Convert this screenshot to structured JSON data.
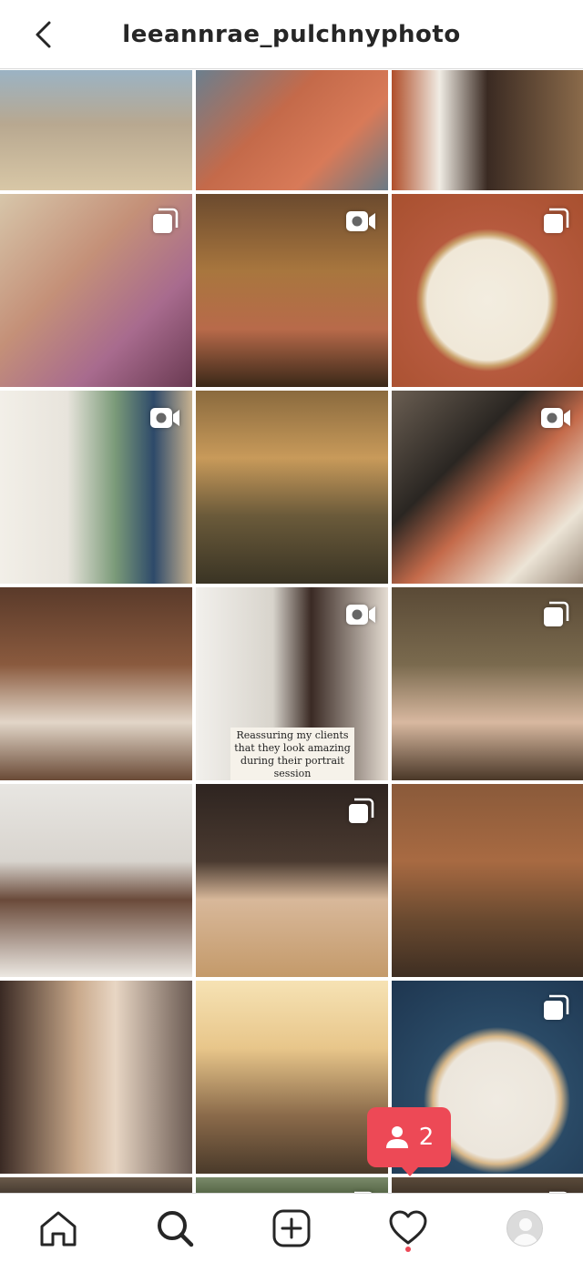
{
  "header": {
    "title": "leeannrae_pulchnyphoto"
  },
  "caption_text": "Reassuring my clients that they look amazing during their portrait session",
  "notification": {
    "count": "2"
  },
  "colors": {
    "accent": "#ed4956",
    "border": "#dbdbdb",
    "text": "#262626"
  },
  "tiles": [
    {
      "desc": "family-beach",
      "icon": "",
      "bg": "linear-gradient(180deg,#9bb3c4 0%,#b8a890 45%,#d8c7a6 100%)"
    },
    {
      "desc": "string-craft",
      "icon": "",
      "bg": "linear-gradient(135deg,#6b7f8e 0%,#c46a4a 40%,#d87a58 70%,#6a7a85 100%)"
    },
    {
      "desc": "woman-porch",
      "icon": "",
      "bg": "linear-gradient(90deg,#b04f2a 0%,#f0ece4 25%,#3a2a22 50%,#8a6a4a 100%)"
    },
    {
      "desc": "mother-baby",
      "icon": "carousel",
      "bg": "linear-gradient(135deg,#d7c6aa 0%,#c49078 40%,#a86b8e 70%,#6a3a52 100%)"
    },
    {
      "desc": "girl-bubbles",
      "icon": "video",
      "bg": "linear-gradient(180deg,#6b4a2e 0%,#a8763e 40%,#b86a4a 70%,#3a2818 100%)"
    },
    {
      "desc": "embroidery-chickens",
      "icon": "carousel",
      "bg": "radial-gradient(circle at 50% 55%,#f3ede0 0%,#f0e8d8 42%,#c9a06a 46%,#b65a3e 50%,#a8502f 100%)"
    },
    {
      "desc": "books-vase",
      "icon": "video",
      "bg": "linear-gradient(90deg,#f2efe8 0%,#e8e4dc 35%,#7a9a78 60%,#2e4a6a 80%,#c8b290 100%)"
    },
    {
      "desc": "mom-kid-river",
      "icon": "",
      "bg": "linear-gradient(180deg,#8a6a3e 0%,#c89a5a 35%,#6a5a3a 65%,#3a3424 100%)"
    },
    {
      "desc": "camera-embroidery",
      "icon": "video",
      "bg": "linear-gradient(135deg,#6a5e52 0%,#2a2622 35%,#c46a4a 55%,#ece4d6 80%,#9a8a7a 100%)"
    },
    {
      "desc": "girl-tree",
      "icon": "",
      "bg": "linear-gradient(180deg,#5a3a2a 0%,#8a5a3e 40%,#e2d6c8 70%,#6a4a36 100%)"
    },
    {
      "desc": "woman-camera",
      "icon": "video",
      "bg": "linear-gradient(90deg,#f2f0ec 0%,#d8d4cc 40%,#3a2a24 60%,#e4dcd2 100%)"
    },
    {
      "desc": "pampas-vase",
      "icon": "carousel",
      "bg": "linear-gradient(180deg,#5a4a36 0%,#7a6a4e 40%,#d8b8a0 70%,#4a3828 100%)"
    },
    {
      "desc": "woman-sweater",
      "icon": "",
      "bg": "linear-gradient(180deg,#e8e6e2 0%,#d8d4ce 40%,#6a4a3a 60%,#ece8e2 100%)"
    },
    {
      "desc": "baby-birthday",
      "icon": "carousel",
      "bg": "linear-gradient(180deg,#2e2420 0%,#4a3a30 40%,#d8b89a 60%,#c49a6a 100%)"
    },
    {
      "desc": "family-big-tree",
      "icon": "",
      "bg": "linear-gradient(180deg,#8a5a3a 0%,#a86a42 40%,#6a4a30 70%,#3e2e22 100%)"
    },
    {
      "desc": "couple-closeup",
      "icon": "",
      "bg": "linear-gradient(90deg,#3a2a24 0%,#c8a88a 40%,#e8d6c4 60%,#6a5a52 100%)"
    },
    {
      "desc": "family-field-sunset",
      "icon": "",
      "bg": "linear-gradient(180deg,#f6e2b4 0%,#e8c68a 35%,#8a6a4a 70%,#4a3a2a 100%)"
    },
    {
      "desc": "embroidery-heart",
      "icon": "carousel",
      "bg": "radial-gradient(circle at 55% 62%,#f0ebe2 0%,#ece6dc 36%,#d8b88a 40%,#2a4a66 46%,#1e3650 100%)"
    },
    {
      "desc": "row-bottom-1",
      "icon": "",
      "bg": "linear-gradient(180deg,#6a5a4a 0%,#3a3028 100%)"
    },
    {
      "desc": "row-bottom-2",
      "icon": "carousel",
      "bg": "linear-gradient(180deg,#7a8a6a 0%,#4a5a3a 100%)"
    },
    {
      "desc": "row-bottom-3",
      "icon": "carousel",
      "bg": "linear-gradient(180deg,#5a4a3a 0%,#3a2e24 100%)"
    }
  ]
}
